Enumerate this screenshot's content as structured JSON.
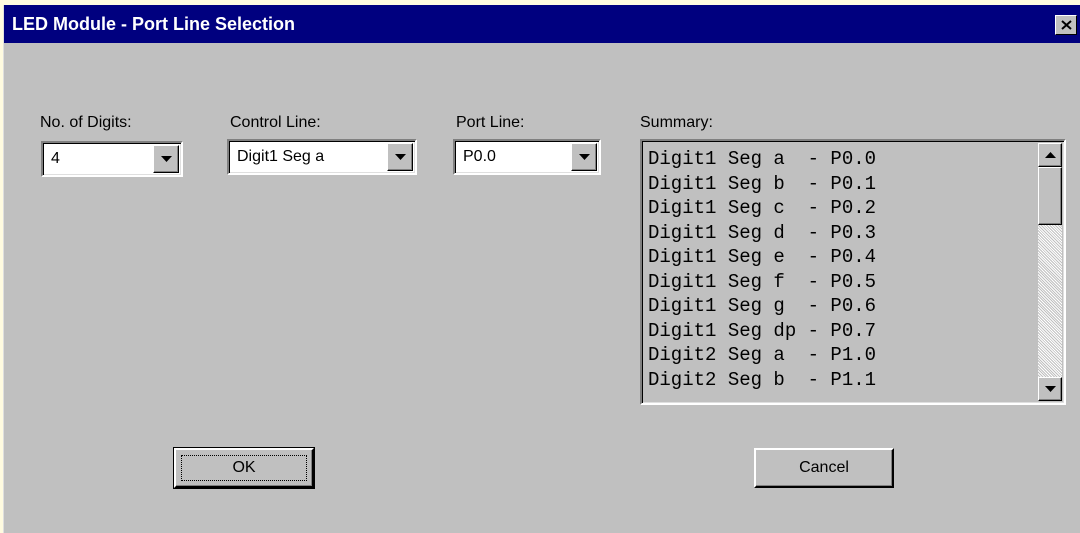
{
  "window": {
    "title": "LED Module - Port Line Selection",
    "title_bar_color": "#00007f",
    "close_icon": "close-icon"
  },
  "digits": {
    "label": "No. of Digits:",
    "value": "4"
  },
  "control_line": {
    "label": "Control Line:",
    "value": "Digit1 Seg a"
  },
  "port_line": {
    "label": "Port Line:",
    "value": "P0.0"
  },
  "summary": {
    "label": "Summary:",
    "items": [
      "Digit1 Seg a  - P0.0",
      "Digit1 Seg b  - P0.1",
      "Digit1 Seg c  - P0.2",
      "Digit1 Seg d  - P0.3",
      "Digit1 Seg e  - P0.4",
      "Digit1 Seg f  - P0.5",
      "Digit1 Seg g  - P0.6",
      "Digit1 Seg dp - P0.7",
      "Digit2 Seg a  - P1.0",
      "Digit2 Seg b  - P1.1"
    ]
  },
  "buttons": {
    "ok_label": "OK",
    "cancel_label": "Cancel"
  }
}
